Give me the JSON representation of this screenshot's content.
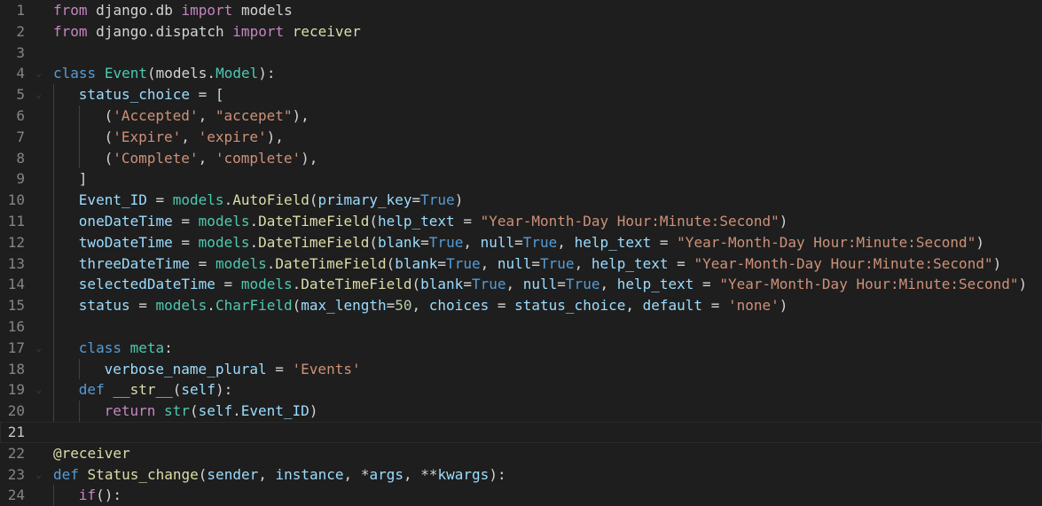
{
  "editor": {
    "lines": [
      {
        "n": "1",
        "indent": 0,
        "fold": false,
        "tokens": [
          [
            "kw-ctl",
            "from"
          ],
          [
            "plain",
            " "
          ],
          [
            "plain",
            "django.db"
          ],
          [
            "plain",
            " "
          ],
          [
            "kw-ctl",
            "import"
          ],
          [
            "plain",
            " models"
          ]
        ]
      },
      {
        "n": "2",
        "indent": 0,
        "fold": false,
        "tokens": [
          [
            "kw-ctl",
            "from"
          ],
          [
            "plain",
            " django.dispatch "
          ],
          [
            "kw-ctl",
            "import"
          ],
          [
            "plain",
            " "
          ],
          [
            "fn",
            "receiver"
          ]
        ]
      },
      {
        "n": "3",
        "indent": 0,
        "fold": false,
        "tokens": []
      },
      {
        "n": "4",
        "indent": 0,
        "fold": true,
        "tokens": [
          [
            "kw",
            "class"
          ],
          [
            "plain",
            " "
          ],
          [
            "cls",
            "Event"
          ],
          [
            "plain",
            "("
          ],
          [
            "plain",
            "models."
          ],
          [
            "cls",
            "Model"
          ],
          [
            "plain",
            "):"
          ]
        ]
      },
      {
        "n": "5",
        "indent": 1,
        "fold": true,
        "tokens": [
          [
            "var",
            "status_choice"
          ],
          [
            "plain",
            " = ["
          ]
        ]
      },
      {
        "n": "6",
        "indent": 2,
        "fold": false,
        "tokens": [
          [
            "plain",
            "("
          ],
          [
            "str",
            "'Accepted'"
          ],
          [
            "plain",
            ", "
          ],
          [
            "str",
            "\"accepet\""
          ],
          [
            "plain",
            "),"
          ]
        ]
      },
      {
        "n": "7",
        "indent": 2,
        "fold": false,
        "tokens": [
          [
            "plain",
            "("
          ],
          [
            "str",
            "'Expire'"
          ],
          [
            "plain",
            ", "
          ],
          [
            "str",
            "'expire'"
          ],
          [
            "plain",
            "),"
          ]
        ]
      },
      {
        "n": "8",
        "indent": 2,
        "fold": false,
        "tokens": [
          [
            "plain",
            "("
          ],
          [
            "str",
            "'Complete'"
          ],
          [
            "plain",
            ", "
          ],
          [
            "str",
            "'complete'"
          ],
          [
            "plain",
            "),"
          ]
        ]
      },
      {
        "n": "9",
        "indent": 1,
        "fold": false,
        "tokens": [
          [
            "plain",
            "]"
          ]
        ]
      },
      {
        "n": "10",
        "indent": 1,
        "fold": false,
        "tokens": [
          [
            "var",
            "Event_ID"
          ],
          [
            "plain",
            " = "
          ],
          [
            "cls",
            "models"
          ],
          [
            "plain",
            "."
          ],
          [
            "fn",
            "AutoField"
          ],
          [
            "plain",
            "("
          ],
          [
            "var",
            "primary_key"
          ],
          [
            "plain",
            "="
          ],
          [
            "kw",
            "True"
          ],
          [
            "plain",
            ")"
          ]
        ]
      },
      {
        "n": "11",
        "indent": 1,
        "fold": false,
        "tokens": [
          [
            "var",
            "oneDateTime"
          ],
          [
            "plain",
            " = "
          ],
          [
            "cls",
            "models"
          ],
          [
            "plain",
            "."
          ],
          [
            "fn",
            "DateTimeField"
          ],
          [
            "plain",
            "("
          ],
          [
            "var",
            "help_text"
          ],
          [
            "plain",
            " = "
          ],
          [
            "str",
            "\"Year-Month-Day Hour:Minute:Second\""
          ],
          [
            "plain",
            ")"
          ]
        ]
      },
      {
        "n": "12",
        "indent": 1,
        "fold": false,
        "tokens": [
          [
            "var",
            "twoDateTime"
          ],
          [
            "plain",
            " = "
          ],
          [
            "cls",
            "models"
          ],
          [
            "plain",
            "."
          ],
          [
            "fn",
            "DateTimeField"
          ],
          [
            "plain",
            "("
          ],
          [
            "var",
            "blank"
          ],
          [
            "plain",
            "="
          ],
          [
            "kw",
            "True"
          ],
          [
            "plain",
            ", "
          ],
          [
            "var",
            "null"
          ],
          [
            "plain",
            "="
          ],
          [
            "kw",
            "True"
          ],
          [
            "plain",
            ", "
          ],
          [
            "var",
            "help_text"
          ],
          [
            "plain",
            " = "
          ],
          [
            "str",
            "\"Year-Month-Day Hour:Minute:Second\""
          ],
          [
            "plain",
            ")"
          ]
        ]
      },
      {
        "n": "13",
        "indent": 1,
        "fold": false,
        "tokens": [
          [
            "var",
            "threeDateTime"
          ],
          [
            "plain",
            " = "
          ],
          [
            "cls",
            "models"
          ],
          [
            "plain",
            "."
          ],
          [
            "fn",
            "DateTimeField"
          ],
          [
            "plain",
            "("
          ],
          [
            "var",
            "blank"
          ],
          [
            "plain",
            "="
          ],
          [
            "kw",
            "True"
          ],
          [
            "plain",
            ", "
          ],
          [
            "var",
            "null"
          ],
          [
            "plain",
            "="
          ],
          [
            "kw",
            "True"
          ],
          [
            "plain",
            ", "
          ],
          [
            "var",
            "help_text"
          ],
          [
            "plain",
            " = "
          ],
          [
            "str",
            "\"Year-Month-Day Hour:Minute:Second\""
          ],
          [
            "plain",
            ")"
          ]
        ]
      },
      {
        "n": "14",
        "indent": 1,
        "fold": false,
        "tokens": [
          [
            "var",
            "selectedDateTime"
          ],
          [
            "plain",
            " = "
          ],
          [
            "cls",
            "models"
          ],
          [
            "plain",
            "."
          ],
          [
            "fn",
            "DateTimeField"
          ],
          [
            "plain",
            "("
          ],
          [
            "var",
            "blank"
          ],
          [
            "plain",
            "="
          ],
          [
            "kw",
            "True"
          ],
          [
            "plain",
            ", "
          ],
          [
            "var",
            "null"
          ],
          [
            "plain",
            "="
          ],
          [
            "kw",
            "True"
          ],
          [
            "plain",
            ", "
          ],
          [
            "var",
            "help_text"
          ],
          [
            "plain",
            " = "
          ],
          [
            "str",
            "\"Year-Month-Day Hour:Minute:Second\""
          ],
          [
            "plain",
            ")"
          ]
        ]
      },
      {
        "n": "15",
        "indent": 1,
        "fold": false,
        "tokens": [
          [
            "var",
            "status"
          ],
          [
            "plain",
            " = "
          ],
          [
            "cls",
            "models"
          ],
          [
            "plain",
            "."
          ],
          [
            "cls",
            "CharField"
          ],
          [
            "plain",
            "("
          ],
          [
            "var",
            "max_length"
          ],
          [
            "plain",
            "="
          ],
          [
            "num",
            "50"
          ],
          [
            "plain",
            ", "
          ],
          [
            "var",
            "choices"
          ],
          [
            "plain",
            " = "
          ],
          [
            "var",
            "status_choice"
          ],
          [
            "plain",
            ", "
          ],
          [
            "var",
            "default"
          ],
          [
            "plain",
            " = "
          ],
          [
            "str",
            "'none'"
          ],
          [
            "plain",
            ")"
          ]
        ]
      },
      {
        "n": "16",
        "indent": 1,
        "fold": false,
        "tokens": []
      },
      {
        "n": "17",
        "indent": 1,
        "fold": true,
        "tokens": [
          [
            "kw",
            "class"
          ],
          [
            "plain",
            " "
          ],
          [
            "cls",
            "meta"
          ],
          [
            "plain",
            ":"
          ]
        ]
      },
      {
        "n": "18",
        "indent": 2,
        "fold": false,
        "tokens": [
          [
            "var",
            "verbose_name_plural"
          ],
          [
            "plain",
            " = "
          ],
          [
            "str",
            "'Events'"
          ]
        ]
      },
      {
        "n": "19",
        "indent": 1,
        "fold": true,
        "tokens": [
          [
            "kw",
            "def"
          ],
          [
            "plain",
            " "
          ],
          [
            "fn",
            "__str__"
          ],
          [
            "plain",
            "("
          ],
          [
            "var",
            "self"
          ],
          [
            "plain",
            "):"
          ]
        ]
      },
      {
        "n": "20",
        "indent": 2,
        "fold": false,
        "tokens": [
          [
            "kw-ctl",
            "return"
          ],
          [
            "plain",
            " "
          ],
          [
            "cls",
            "str"
          ],
          [
            "plain",
            "("
          ],
          [
            "var",
            "self"
          ],
          [
            "plain",
            "."
          ],
          [
            "var",
            "Event_ID"
          ],
          [
            "plain",
            ")"
          ]
        ]
      },
      {
        "n": "21",
        "indent": 0,
        "fold": false,
        "current": true,
        "tokens": []
      },
      {
        "n": "22",
        "indent": 0,
        "fold": false,
        "tokens": [
          [
            "fn",
            "@receiver"
          ]
        ]
      },
      {
        "n": "23",
        "indent": 0,
        "fold": true,
        "tokens": [
          [
            "kw",
            "def"
          ],
          [
            "plain",
            " "
          ],
          [
            "fn",
            "Status_change"
          ],
          [
            "plain",
            "("
          ],
          [
            "var",
            "sender"
          ],
          [
            "plain",
            ", "
          ],
          [
            "var",
            "instance"
          ],
          [
            "plain",
            ", *"
          ],
          [
            "var",
            "args"
          ],
          [
            "plain",
            ", **"
          ],
          [
            "var",
            "kwargs"
          ],
          [
            "plain",
            "):"
          ]
        ]
      },
      {
        "n": "24",
        "indent": 1,
        "fold": false,
        "tokens": [
          [
            "kw-ctl",
            "if"
          ],
          [
            "plain",
            "():"
          ]
        ]
      }
    ]
  }
}
